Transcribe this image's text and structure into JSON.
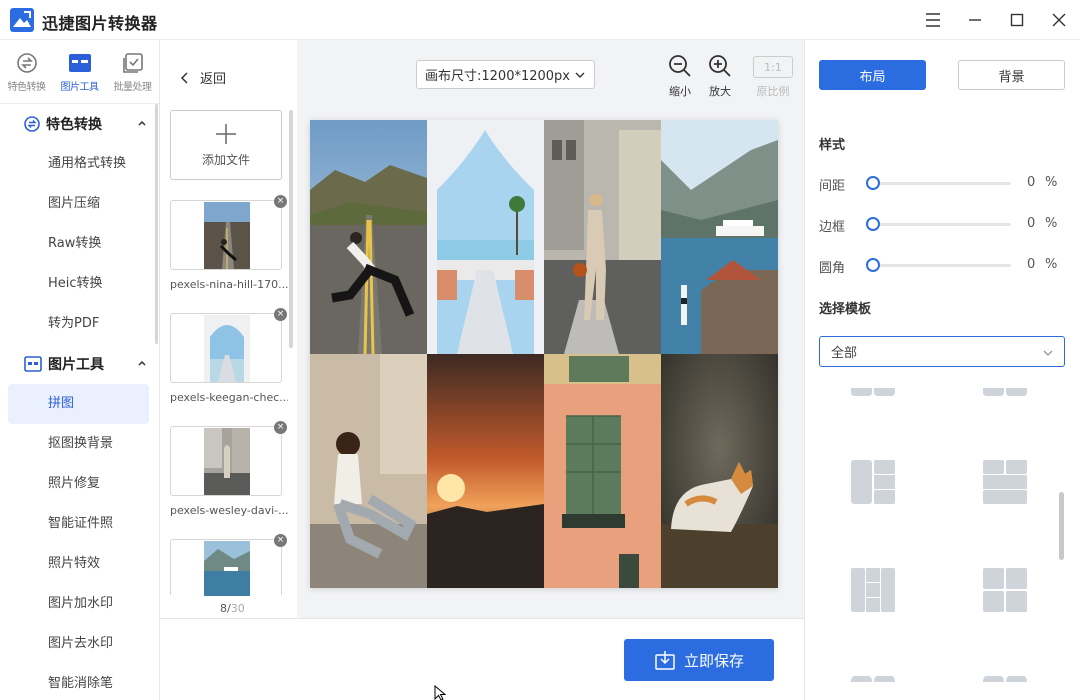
{
  "app": {
    "title": "迅捷图片转换器"
  },
  "sidebar": {
    "top_tabs": [
      {
        "label": "特色转换",
        "icon": "convert-icon"
      },
      {
        "label": "图片工具",
        "icon": "image-tool-icon"
      },
      {
        "label": "批量处理",
        "icon": "batch-icon"
      }
    ],
    "section1": {
      "title": "特色转换",
      "items": [
        "通用格式转换",
        "图片压缩",
        "Raw转换",
        "Heic转换",
        "转为PDF"
      ]
    },
    "section2": {
      "title": "图片工具",
      "items": [
        "拼图",
        "抠图换背景",
        "照片修复",
        "智能证件照",
        "照片特效",
        "图片加水印",
        "图片去水印",
        "智能消除笔"
      ]
    }
  },
  "files": {
    "back_label": "返回",
    "add_label": "添加文件",
    "items": [
      {
        "name": "pexels-nina-hill-170..."
      },
      {
        "name": "pexels-keegan-chec..."
      },
      {
        "name": "pexels-wesley-davi-..."
      },
      {
        "name": ""
      }
    ],
    "page_current": "8",
    "page_sep": "/",
    "page_total": "30"
  },
  "toolbar": {
    "canvas_size": "画布尺寸:1200*1200px",
    "zoom_out": "缩小",
    "zoom_in": "放大",
    "ratio_box": "1:1",
    "ratio": "原比例"
  },
  "save_label": "立即保存",
  "panel": {
    "tab_layout": "布局",
    "tab_background": "背景",
    "style_title": "样式",
    "sliders": [
      {
        "label": "间距",
        "value": "0",
        "unit": "%"
      },
      {
        "label": "边框",
        "value": "0",
        "unit": "%"
      },
      {
        "label": "圆角",
        "value": "0",
        "unit": "%"
      }
    ],
    "template_title": "选择模板",
    "template_select": "全部"
  },
  "colors": {
    "accent": "#2b6de0",
    "template_gray": "#cfd3da"
  }
}
